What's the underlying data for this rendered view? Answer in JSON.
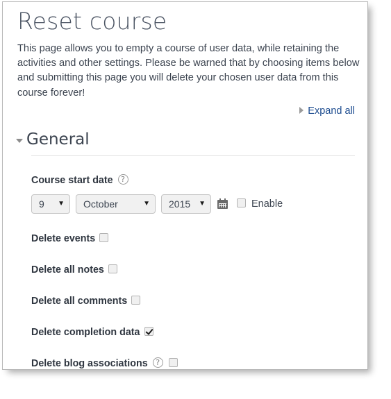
{
  "page": {
    "title": "Reset course",
    "intro": "This page allows you to empty a course of user data, while retaining the activities and other settings. Please be warned that by choosing items below and submitting this page you will delete your chosen user data from this course forever!",
    "expand_all": "Expand all",
    "expand_all_icon": "triangle-right-icon",
    "link_color": "#1a4a8e"
  },
  "section": {
    "title": "General",
    "collapse_icon": "triangle-down-icon"
  },
  "course_start_date": {
    "label": "Course start date",
    "help_icon": "help-circle-icon",
    "calendar_icon": "calendar-icon",
    "day": {
      "value": "9",
      "caret": "▼"
    },
    "month": {
      "value": "October",
      "caret": "▼"
    },
    "year": {
      "value": "2015",
      "caret": "▼"
    },
    "enable": {
      "label": "Enable",
      "checked": false
    }
  },
  "options": [
    {
      "label": "Delete events",
      "checked": false,
      "help": false
    },
    {
      "label": "Delete all notes",
      "checked": false,
      "help": false
    },
    {
      "label": "Delete all comments",
      "checked": false,
      "help": false
    },
    {
      "label": "Delete completion data",
      "checked": true,
      "help": false
    },
    {
      "label": "Delete blog associations",
      "checked": false,
      "help": true
    }
  ]
}
